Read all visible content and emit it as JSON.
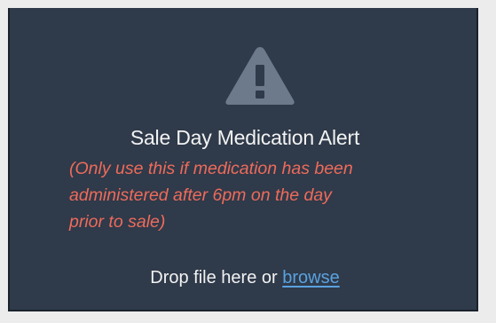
{
  "dropzone": {
    "icon": "warning-triangle-icon",
    "title": "Sale Day Medication Alert",
    "note_lines": [
      "(Only use this if medication has been",
      "administered after 6pm on the day",
      "prior to sale)"
    ],
    "drop_text": "Drop file here or ",
    "browse_label": "browse"
  },
  "colors": {
    "panel_bg": "#2f3a4a",
    "page_bg": "#ececec",
    "title_text": "#f2f2f2",
    "alert_text": "#ee6b5a",
    "link": "#5aa2e0",
    "icon": "#6c7a8c"
  }
}
